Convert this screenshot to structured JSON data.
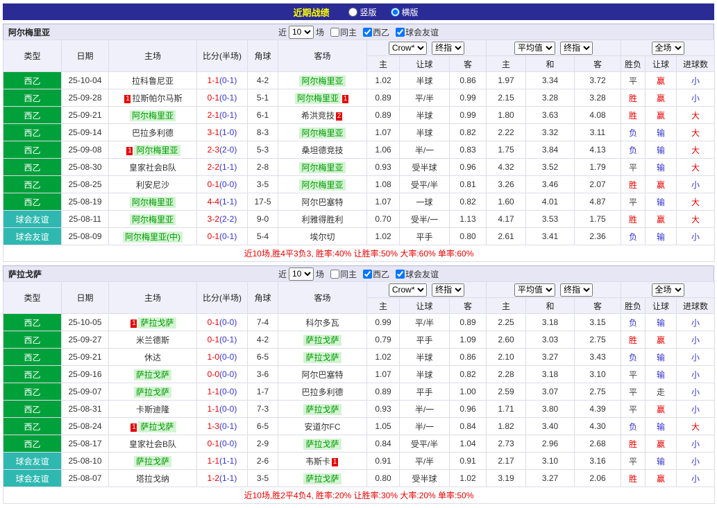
{
  "title_bar": {
    "title": "近期战绩",
    "vertical_label": "竖版",
    "horizontal_label": "横版",
    "selected": "横版"
  },
  "filter_bar": {
    "near": "近",
    "count": "10",
    "games": "场",
    "same_home": "同主",
    "league": "西乙",
    "friendly": "球会友谊",
    "same_home_checked": false,
    "league_checked": true,
    "friendly_checked": true
  },
  "table_headers": {
    "type": "类型",
    "date": "日期",
    "home": "主场",
    "score": "比分(半场)",
    "corner": "角球",
    "away": "客场",
    "source1": "Crow*",
    "final1": "终指",
    "source2": "平均值",
    "final2": "终指",
    "scope": "全场",
    "odds_home": "主",
    "odds_handicap": "让球",
    "odds_away": "客",
    "avg_home": "主",
    "avg_draw": "和",
    "avg_away": "客",
    "result": "胜负",
    "handicap_result": "让球",
    "goals": "进球数"
  },
  "colors": {
    "topbar_navy": "#2b2b96",
    "league_green": "#00a13a",
    "friendly_teal": "#2eb8b0",
    "highlight_green": "#009900",
    "win_red": "#e60000",
    "lose_blue": "#3333cc"
  },
  "sections": [
    {
      "team": "阿尔梅里亚",
      "rows": [
        {
          "type": "西乙",
          "date": "25-10-04",
          "home": "拉科鲁尼亚",
          "home_card": 0,
          "home_hl": false,
          "score": "1-1",
          "half": "(0-1)",
          "corner": "4-2",
          "away": "阿尔梅里亚",
          "away_card": 0,
          "away_hl": true,
          "crow": [
            "1.02",
            "半球",
            "0.86"
          ],
          "avg": [
            "1.97",
            "3.34",
            "3.72"
          ],
          "res": [
            "平",
            "赢",
            "小"
          ]
        },
        {
          "type": "西乙",
          "date": "25-09-28",
          "home": "拉斯帕尔马斯",
          "home_card": 1,
          "home_hl": false,
          "score": "0-1",
          "half": "(0-1)",
          "corner": "5-1",
          "away": "阿尔梅里亚",
          "away_card": 1,
          "away_hl": true,
          "crow": [
            "0.89",
            "平/半",
            "0.99"
          ],
          "avg": [
            "2.15",
            "3.28",
            "3.28"
          ],
          "res": [
            "胜",
            "赢",
            "小"
          ]
        },
        {
          "type": "西乙",
          "date": "25-09-21",
          "home": "阿尔梅里亚",
          "home_card": 0,
          "home_hl": true,
          "score": "2-1",
          "half": "(0-1)",
          "corner": "6-1",
          "away": "希洪竞技",
          "away_card": 2,
          "away_hl": false,
          "crow": [
            "0.89",
            "半球",
            "0.99"
          ],
          "avg": [
            "1.80",
            "3.63",
            "4.08"
          ],
          "res": [
            "胜",
            "赢",
            "大"
          ]
        },
        {
          "type": "西乙",
          "date": "25-09-14",
          "home": "巴拉多利德",
          "home_card": 0,
          "home_hl": false,
          "score": "3-1",
          "half": "(1-0)",
          "corner": "8-3",
          "away": "阿尔梅里亚",
          "away_card": 0,
          "away_hl": true,
          "crow": [
            "1.07",
            "半球",
            "0.82"
          ],
          "avg": [
            "2.22",
            "3.32",
            "3.11"
          ],
          "res": [
            "负",
            "输",
            "大"
          ]
        },
        {
          "type": "西乙",
          "date": "25-09-08",
          "home": "阿尔梅里亚",
          "home_card": 1,
          "home_hl": true,
          "score": "2-3",
          "half": "(2-0)",
          "corner": "5-3",
          "away": "桑坦德竞技",
          "away_card": 0,
          "away_hl": false,
          "crow": [
            "1.06",
            "半/一",
            "0.83"
          ],
          "avg": [
            "1.75",
            "3.84",
            "4.13"
          ],
          "res": [
            "负",
            "输",
            "大"
          ]
        },
        {
          "type": "西乙",
          "date": "25-08-30",
          "home": "皇家社会B队",
          "home_card": 0,
          "home_hl": false,
          "score": "2-2",
          "half": "(1-1)",
          "corner": "2-8",
          "away": "阿尔梅里亚",
          "away_card": 0,
          "away_hl": true,
          "crow": [
            "0.93",
            "受半球",
            "0.96"
          ],
          "avg": [
            "4.32",
            "3.52",
            "1.79"
          ],
          "res": [
            "平",
            "输",
            "大"
          ]
        },
        {
          "type": "西乙",
          "date": "25-08-25",
          "home": "利安尼沙",
          "home_card": 0,
          "home_hl": false,
          "score": "0-1",
          "half": "(0-0)",
          "corner": "3-5",
          "away": "阿尔梅里亚",
          "away_card": 0,
          "away_hl": true,
          "crow": [
            "1.08",
            "受平/半",
            "0.81"
          ],
          "avg": [
            "3.26",
            "3.46",
            "2.07"
          ],
          "res": [
            "胜",
            "赢",
            "小"
          ]
        },
        {
          "type": "西乙",
          "date": "25-08-19",
          "home": "阿尔梅里亚",
          "home_card": 0,
          "home_hl": true,
          "score": "4-4",
          "half": "(1-1)",
          "corner": "17-5",
          "away": "阿尔巴塞特",
          "away_card": 0,
          "away_hl": false,
          "crow": [
            "1.07",
            "一球",
            "0.82"
          ],
          "avg": [
            "1.60",
            "4.01",
            "4.87"
          ],
          "res": [
            "平",
            "输",
            "大"
          ]
        },
        {
          "type": "球会友谊",
          "date": "25-08-11",
          "home": "阿尔梅里亚",
          "home_card": 0,
          "home_hl": true,
          "score": "3-2",
          "half": "(2-2)",
          "corner": "9-0",
          "away": "利雅得胜利",
          "away_card": 0,
          "away_hl": false,
          "crow": [
            "0.70",
            "受半/一",
            "1.13"
          ],
          "avg": [
            "4.17",
            "3.53",
            "1.75"
          ],
          "res": [
            "胜",
            "赢",
            "大"
          ]
        },
        {
          "type": "球会友谊",
          "date": "25-08-09",
          "home": "阿尔梅里亚(中)",
          "home_card": 0,
          "home_hl": true,
          "score": "0-1",
          "half": "(0-1)",
          "corner": "5-4",
          "away": "埃尔切",
          "away_card": 0,
          "away_hl": false,
          "crow": [
            "1.02",
            "平手",
            "0.80"
          ],
          "avg": [
            "2.61",
            "3.41",
            "2.36"
          ],
          "res": [
            "负",
            "输",
            "小"
          ]
        }
      ],
      "summary": "近10场,胜4平3负3, 胜率:40% 让胜率:50% 大率:60% 单率:60%"
    },
    {
      "team": "萨拉戈萨",
      "rows": [
        {
          "type": "西乙",
          "date": "25-10-05",
          "home": "萨拉戈萨",
          "home_card": 1,
          "home_hl": true,
          "score": "0-1",
          "half": "(0-0)",
          "corner": "7-4",
          "away": "科尔多瓦",
          "away_card": 0,
          "away_hl": false,
          "crow": [
            "0.99",
            "平/半",
            "0.89"
          ],
          "avg": [
            "2.25",
            "3.18",
            "3.15"
          ],
          "res": [
            "负",
            "输",
            "小"
          ]
        },
        {
          "type": "西乙",
          "date": "25-09-27",
          "home": "米兰德斯",
          "home_card": 0,
          "home_hl": false,
          "score": "0-1",
          "half": "(0-1)",
          "corner": "4-2",
          "away": "萨拉戈萨",
          "away_card": 0,
          "away_hl": true,
          "crow": [
            "0.79",
            "平手",
            "1.09"
          ],
          "avg": [
            "2.60",
            "3.03",
            "2.75"
          ],
          "res": [
            "胜",
            "赢",
            "小"
          ]
        },
        {
          "type": "西乙",
          "date": "25-09-21",
          "home": "休达",
          "home_card": 0,
          "home_hl": false,
          "score": "1-0",
          "half": "(0-0)",
          "corner": "6-5",
          "away": "萨拉戈萨",
          "away_card": 0,
          "away_hl": true,
          "crow": [
            "1.02",
            "半球",
            "0.86"
          ],
          "avg": [
            "2.10",
            "3.27",
            "3.43"
          ],
          "res": [
            "负",
            "输",
            "小"
          ]
        },
        {
          "type": "西乙",
          "date": "25-09-16",
          "home": "萨拉戈萨",
          "home_card": 0,
          "home_hl": true,
          "score": "0-0",
          "half": "(0-0)",
          "corner": "3-6",
          "away": "阿尔巴塞特",
          "away_card": 0,
          "away_hl": false,
          "crow": [
            "1.07",
            "半球",
            "0.82"
          ],
          "avg": [
            "2.28",
            "3.18",
            "3.10"
          ],
          "res": [
            "平",
            "输",
            "小"
          ]
        },
        {
          "type": "西乙",
          "date": "25-09-07",
          "home": "萨拉戈萨",
          "home_card": 0,
          "home_hl": true,
          "score": "1-1",
          "half": "(0-0)",
          "corner": "1-7",
          "away": "巴拉多利德",
          "away_card": 0,
          "away_hl": false,
          "crow": [
            "0.89",
            "平手",
            "1.00"
          ],
          "avg": [
            "2.59",
            "3.07",
            "2.75"
          ],
          "res": [
            "平",
            "走",
            "小"
          ]
        },
        {
          "type": "西乙",
          "date": "25-08-31",
          "home": "卡斯迪隆",
          "home_card": 0,
          "home_hl": false,
          "score": "1-1",
          "half": "(0-0)",
          "corner": "7-3",
          "away": "萨拉戈萨",
          "away_card": 0,
          "away_hl": true,
          "crow": [
            "0.93",
            "半/一",
            "0.96"
          ],
          "avg": [
            "1.71",
            "3.80",
            "4.39"
          ],
          "res": [
            "平",
            "赢",
            "小"
          ]
        },
        {
          "type": "西乙",
          "date": "25-08-24",
          "home": "萨拉戈萨",
          "home_card": 1,
          "home_hl": true,
          "score": "1-3",
          "half": "(0-1)",
          "corner": "6-5",
          "away": "安道尔FC",
          "away_card": 0,
          "away_hl": false,
          "crow": [
            "1.05",
            "半/一",
            "0.84"
          ],
          "avg": [
            "1.82",
            "3.40",
            "4.30"
          ],
          "res": [
            "负",
            "输",
            "大"
          ]
        },
        {
          "type": "西乙",
          "date": "25-08-17",
          "home": "皇家社会B队",
          "home_card": 0,
          "home_hl": false,
          "score": "0-1",
          "half": "(0-0)",
          "corner": "2-9",
          "away": "萨拉戈萨",
          "away_card": 0,
          "away_hl": true,
          "crow": [
            "0.84",
            "受平/半",
            "1.04"
          ],
          "avg": [
            "2.73",
            "2.96",
            "2.68"
          ],
          "res": [
            "胜",
            "赢",
            "小"
          ]
        },
        {
          "type": "球会友谊",
          "date": "25-08-10",
          "home": "萨拉戈萨",
          "home_card": 0,
          "home_hl": true,
          "score": "1-1",
          "half": "(1-1)",
          "corner": "2-6",
          "away": "韦斯卡",
          "away_card": 1,
          "away_hl": false,
          "crow": [
            "0.91",
            "平/半",
            "0.91"
          ],
          "avg": [
            "2.17",
            "3.10",
            "3.16"
          ],
          "res": [
            "平",
            "输",
            "小"
          ]
        },
        {
          "type": "球会友谊",
          "date": "25-08-07",
          "home": "塔拉戈纳",
          "home_card": 0,
          "home_hl": false,
          "score": "1-2",
          "half": "(1-1)",
          "corner": "3-5",
          "away": "萨拉戈萨",
          "away_card": 0,
          "away_hl": true,
          "crow": [
            "0.80",
            "受半球",
            "1.02"
          ],
          "avg": [
            "3.19",
            "3.27",
            "2.06"
          ],
          "res": [
            "胜",
            "赢",
            "小"
          ]
        }
      ],
      "summary": "近10场,胜2平4负4, 胜率:20% 让胜率:30% 大率:20% 单率:50%"
    }
  ]
}
